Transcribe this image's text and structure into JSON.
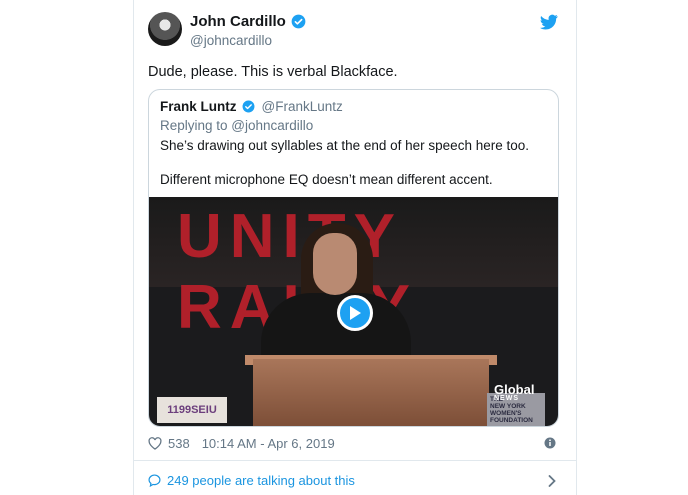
{
  "tweet": {
    "author_name": "John Cardillo",
    "author_handle": "@johncardillo",
    "text": "Dude, please. This is verbal Blackface.",
    "likes": "538",
    "timestamp": "10:14 AM - Apr 6, 2019",
    "talking": "249 people are talking about this"
  },
  "quoted": {
    "author_name": "Frank Luntz",
    "author_handle": "@FrankLuntz",
    "replying_to": "Replying to @johncardillo",
    "text_line1": "She’s drawing out syllables at the end of her speech here too.",
    "text_line2": "Different microphone EQ doesn’t mean different accent.",
    "video": {
      "banner_text": "UNITY RALLY",
      "sign_left": "1199SEIU",
      "sign_right": "THE\nNEW YORK\nWOMEN'S\nFOUNDATION",
      "watermark": "Global",
      "watermark_sub": "NEWS"
    }
  },
  "colors": {
    "accent": "#1da1f2",
    "link": "#1b95e0",
    "muted": "#657786",
    "banner_red": "#b0202a"
  },
  "icons": [
    "verified-icon",
    "twitter-bird-icon",
    "heart-icon",
    "info-icon",
    "speech-bubble-icon",
    "chevron-right-icon",
    "play-icon"
  ]
}
